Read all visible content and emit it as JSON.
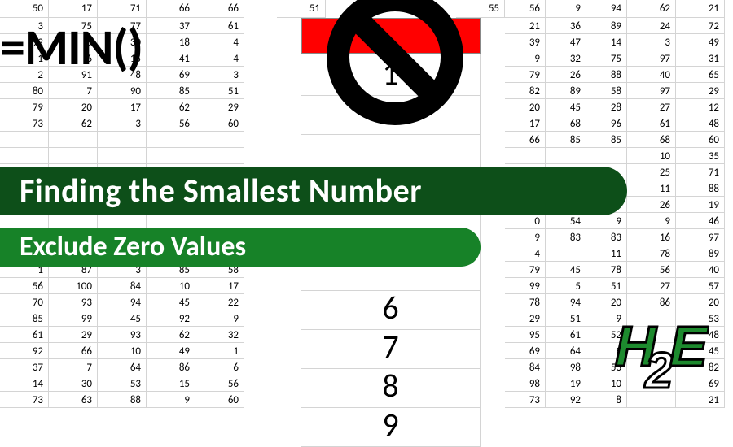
{
  "formula": "=MIN()",
  "banner_main": "Finding the Smallest Number",
  "banner_sub": "Exclude Zero Values",
  "top_row": {
    "c0": "50",
    "c1": "17",
    "c2": "71",
    "c3": "66",
    "c4": "66",
    "c5": "51",
    "c6": "55",
    "c7": "56",
    "c8": "9",
    "c9": "94",
    "c10": "62",
    "c11": "21"
  },
  "left_grid": [
    [
      "3",
      "75",
      "77",
      "37",
      "61"
    ],
    [
      "92",
      "8",
      "30",
      "18",
      "4"
    ],
    [
      "1",
      "6",
      "15",
      "41",
      "4"
    ],
    [
      "2",
      "91",
      "48",
      "69",
      "3"
    ],
    [
      "80",
      "7",
      "90",
      "85",
      "51"
    ],
    [
      "79",
      "20",
      "17",
      "62",
      "29"
    ],
    [
      "73",
      "62",
      "3",
      "56",
      "60"
    ],
    [
      "",
      "",
      "",
      "",
      ""
    ],
    [
      "",
      "",
      "",
      "",
      ""
    ],
    [
      "",
      "",
      "",
      "",
      ""
    ],
    [
      "",
      "",
      "",
      "",
      ""
    ],
    [
      "",
      "",
      "",
      "",
      ""
    ],
    [
      "",
      "",
      "",
      "",
      ""
    ],
    [
      "",
      "",
      "",
      "",
      ""
    ],
    [
      "",
      "",
      "",
      "",
      ""
    ],
    [
      "1",
      "87",
      "3",
      "85",
      "58"
    ],
    [
      "56",
      "100",
      "84",
      "10",
      "17"
    ],
    [
      "70",
      "93",
      "94",
      "45",
      "22"
    ],
    [
      "85",
      "99",
      "45",
      "92",
      "9"
    ],
    [
      "61",
      "29",
      "93",
      "62",
      "32"
    ],
    [
      "92",
      "66",
      "10",
      "49",
      "1"
    ],
    [
      "37",
      "7",
      "64",
      "86",
      "6"
    ],
    [
      "14",
      "30",
      "53",
      "15",
      "56"
    ],
    [
      "73",
      "63",
      "88",
      "9",
      "60"
    ]
  ],
  "right_grid": [
    [
      "21",
      "36",
      "89",
      "24",
      "72"
    ],
    [
      "39",
      "47",
      "14",
      "3",
      "49"
    ],
    [
      "9",
      "32",
      "75",
      "97",
      "31"
    ],
    [
      "79",
      "26",
      "88",
      "40",
      "65"
    ],
    [
      "82",
      "89",
      "58",
      "97",
      "29"
    ],
    [
      "20",
      "45",
      "28",
      "27",
      "12"
    ],
    [
      "17",
      "68",
      "96",
      "61",
      "48"
    ],
    [
      "66",
      "85",
      "85",
      "68",
      "60"
    ],
    [
      "",
      "",
      "",
      "10",
      "35"
    ],
    [
      "",
      "",
      "",
      "25",
      "71"
    ],
    [
      "",
      "",
      "",
      "11",
      "88"
    ],
    [
      "",
      "",
      "",
      "26",
      "19"
    ],
    [
      "0",
      "54",
      "9",
      "9",
      "46"
    ],
    [
      "9",
      "83",
      "83",
      "16",
      "97"
    ],
    [
      "4",
      "",
      "11",
      "78",
      "89"
    ],
    [
      "79",
      "45",
      "78",
      "56",
      "40"
    ],
    [
      "99",
      "5",
      "51",
      "27",
      "57"
    ],
    [
      "78",
      "94",
      "20",
      "86",
      "20"
    ],
    [
      "29",
      "51",
      "9",
      "",
      "53"
    ],
    [
      "95",
      "61",
      "52",
      "",
      "48"
    ],
    [
      "69",
      "64",
      "9",
      "",
      "45"
    ],
    [
      "84",
      "98",
      "53",
      "",
      "82"
    ],
    [
      "98",
      "19",
      "10",
      "",
      "69"
    ],
    [
      "73",
      "92",
      "8",
      "",
      "21"
    ]
  ],
  "big_nums": [
    "1",
    "",
    "",
    "",
    "",
    "",
    "6",
    "7",
    "8",
    "9"
  ],
  "logo": {
    "h": "H",
    "two": "2",
    "e": "E"
  }
}
